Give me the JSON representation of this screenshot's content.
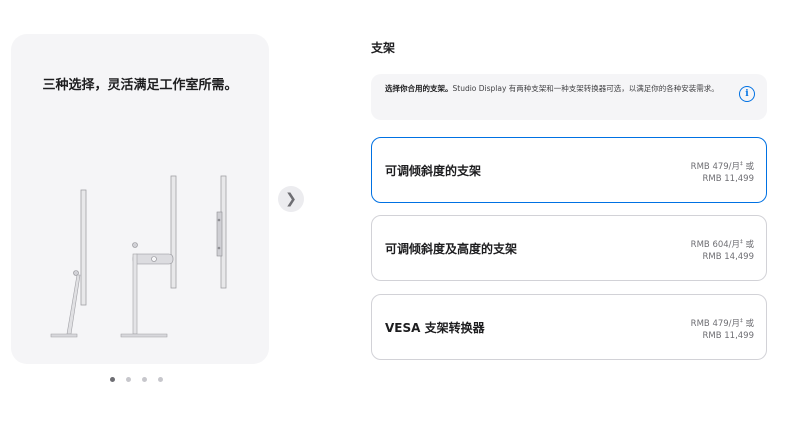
{
  "gallery": {
    "caption": "三种选择，灵活满足工作室所需。",
    "active_slide": 1,
    "slide_count": 4
  },
  "section": {
    "title": "支架"
  },
  "info": {
    "bold": "选择你合用的支架。",
    "text": "Studio Display 有两种支架和一种支架转换器可选，以满足你的各种安装需求。",
    "icon": "info-icon"
  },
  "options": [
    {
      "label": "可调倾斜度的支架",
      "monthly": "RMB 479/月",
      "mark": "‡",
      "or": " 或",
      "total": "RMB 11,499",
      "selected": true
    },
    {
      "label": "可调倾斜度及高度的支架",
      "monthly": "RMB 604/月",
      "mark": "‡",
      "or": " 或",
      "total": "RMB 14,499",
      "selected": false
    },
    {
      "label": "VESA 支架转换器",
      "monthly": "RMB 479/月",
      "mark": "‡",
      "or": " 或",
      "total": "RMB 11,499",
      "selected": false
    }
  ],
  "colors": {
    "accent": "#0071e3",
    "panel": "#f5f5f7",
    "border": "#d2d2d7"
  }
}
